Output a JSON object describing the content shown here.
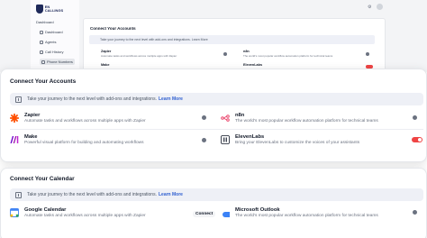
{
  "background": {
    "logo_text": "EN CALLINGS",
    "nav": [
      "Dashboard",
      "Dashboard",
      "Agents",
      "Call History",
      "Phone Numbers"
    ],
    "title": "Connect Your Accounts",
    "banner": "Take your journey to the next level with add-ons and integrations. Learn More",
    "rows": [
      {
        "name": "Zapier",
        "desc": "Automate tasks and workflows across multiple apps with Zapier"
      },
      {
        "name": "n8n",
        "desc": "The world's most popular workflow automation platform for technical teams"
      },
      {
        "name": "Make",
        "desc": ""
      },
      {
        "name": "ElevenLabs",
        "desc": ""
      }
    ]
  },
  "accounts": {
    "title": "Connect Your Accounts",
    "banner_text": "Take your journey to the next level with add-ons and integrations.",
    "banner_link": "Learn More",
    "integrations": [
      {
        "name": "Zapier",
        "desc": "Automate tasks and workflows across multiple apps with Zapier",
        "icon": "zapier-icon",
        "color": "#ff4f00"
      },
      {
        "name": "n8n",
        "desc": "The world's most popular workflow automation platform for technical teams",
        "icon": "n8n-icon",
        "color": "#ea4b71"
      },
      {
        "name": "Make",
        "desc": "Powerful visual platform for building and automating workflows",
        "icon": "make-icon",
        "color": "#6d00cc"
      },
      {
        "name": "ElevenLabs",
        "desc": "Bring your ElevenLabs to customize the voices of your assistants",
        "icon": "elevenlabs-icon",
        "color": "#000000"
      }
    ]
  },
  "calendar": {
    "title": "Connect Your Calendar",
    "banner_text": "Take your journey to the next level with add-ons and integrations.",
    "banner_link": "Learn More",
    "integrations": [
      {
        "name": "Google Calendar",
        "desc": "Automate tasks and workflows across multiple apps with Zapier",
        "icon": "google-calendar-icon",
        "action": "Connect"
      },
      {
        "name": "Microsoft Outlook",
        "desc": "The world's most popular workflow automation platform for technical teams",
        "icon": "outlook-icon"
      }
    ]
  },
  "colors": {
    "accent": "#2f5fd0",
    "toggle_on": "#ef4444"
  }
}
